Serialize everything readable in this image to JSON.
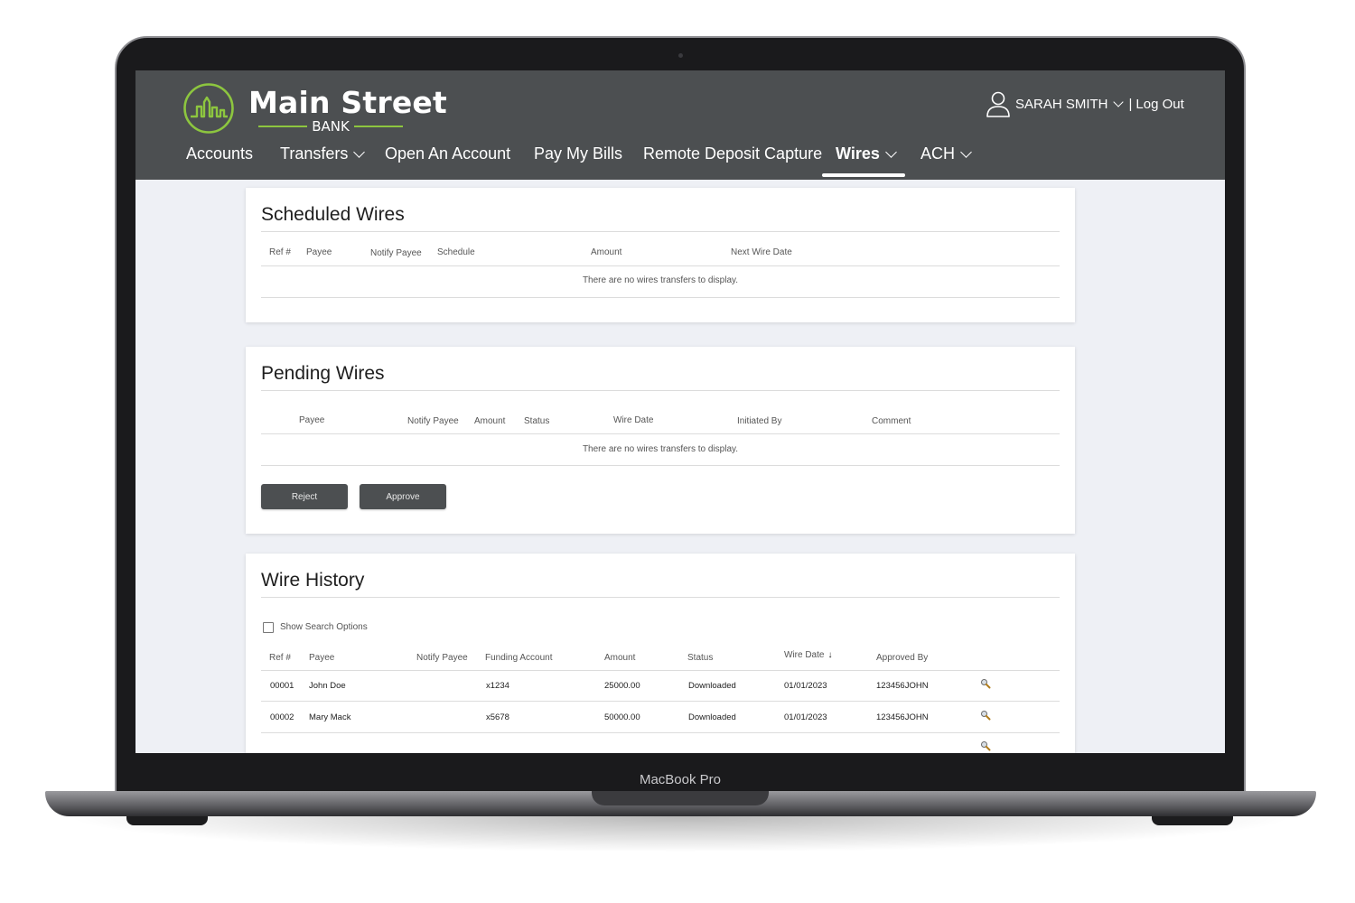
{
  "device": {
    "label": "MacBook Pro"
  },
  "header": {
    "logo_name": "Main Street",
    "logo_sub": "BANK",
    "user_name": "SARAH SMITH",
    "separator": "|",
    "logout": "Log Out"
  },
  "nav": {
    "items": [
      {
        "label": "Accounts"
      },
      {
        "label": "Transfers"
      },
      {
        "label": "Open An Account"
      },
      {
        "label": "Pay My Bills"
      },
      {
        "label": "Remote Deposit Capture"
      },
      {
        "label": "Wires"
      },
      {
        "label": "ACH"
      }
    ],
    "active": "Wires"
  },
  "scheduled": {
    "title": "Scheduled Wires",
    "columns": [
      "Ref #",
      "Payee",
      "Notify Payee",
      "Schedule",
      "Amount",
      "Next Wire Date"
    ],
    "empty": "There are no wires transfers to display."
  },
  "pending": {
    "title": "Pending Wires",
    "columns": [
      "Payee",
      "Notify Payee",
      "Amount",
      "Status",
      "Wire Date",
      "Initiated By",
      "Comment"
    ],
    "empty": "There are no wires transfers to display.",
    "reject_label": "Reject",
    "approve_label": "Approve"
  },
  "history": {
    "title": "Wire History",
    "search_option": "Show Search Options",
    "search_checked": false,
    "columns": [
      "Ref #",
      "Payee",
      "Notify Payee",
      "Funding Account",
      "Amount",
      "Status",
      "Wire Date",
      "Approved By"
    ],
    "sort_indicator": "↓",
    "rows": [
      {
        "ref": "00001",
        "payee": "John Doe",
        "notify": "",
        "account": "x1234",
        "amount": "25000.00",
        "status": "Downloaded",
        "date": "01/01/2023",
        "approved": "123456JOHN",
        "action_icon": "magnifier-icon"
      },
      {
        "ref": "00002",
        "payee": "Mary Mack",
        "notify": "",
        "account": "x5678",
        "amount": "50000.00",
        "status": "Downloaded",
        "date": "01/01/2023",
        "approved": "123456JOHN",
        "action_icon": "magnifier-icon"
      }
    ]
  },
  "colors": {
    "header_bg": "#4c4f51",
    "brand_green": "#8dc63f",
    "page_bg": "#eef0f5",
    "button_bg": "#4c4f51"
  }
}
